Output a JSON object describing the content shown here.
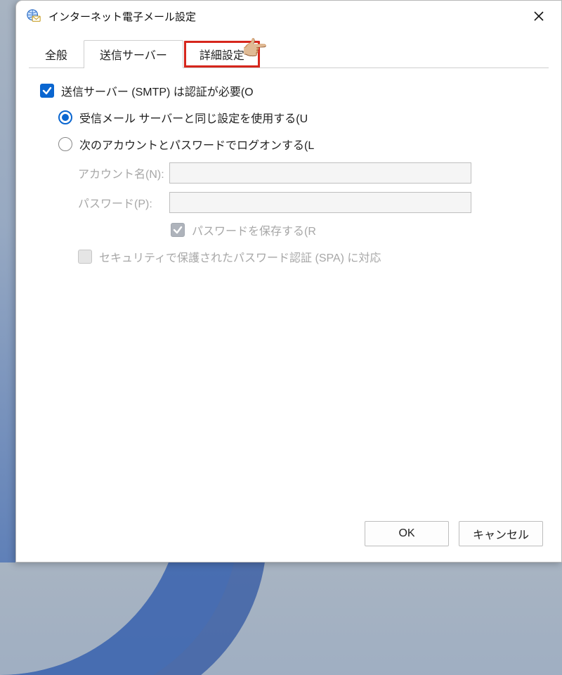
{
  "window": {
    "title": "インターネット電子メール設定"
  },
  "tabs": {
    "general": "全般",
    "outgoing": "送信サーバー",
    "advanced": "詳細設定"
  },
  "form": {
    "smtp_auth_required": "送信サーバー (SMTP) は認証が必要(O",
    "use_same_settings": "受信メール サーバーと同じ設定を使用する(U",
    "logon_with_account": "次のアカウントとパスワードでログオンする(L",
    "account_label": "アカウント名(N):",
    "password_label": "パスワード(P):",
    "remember_password": "パスワードを保存する(R",
    "spa_support": "セキュリティで保護されたパスワード認証 (SPA) に対応"
  },
  "buttons": {
    "ok": "OK",
    "cancel": "キャンセル"
  }
}
